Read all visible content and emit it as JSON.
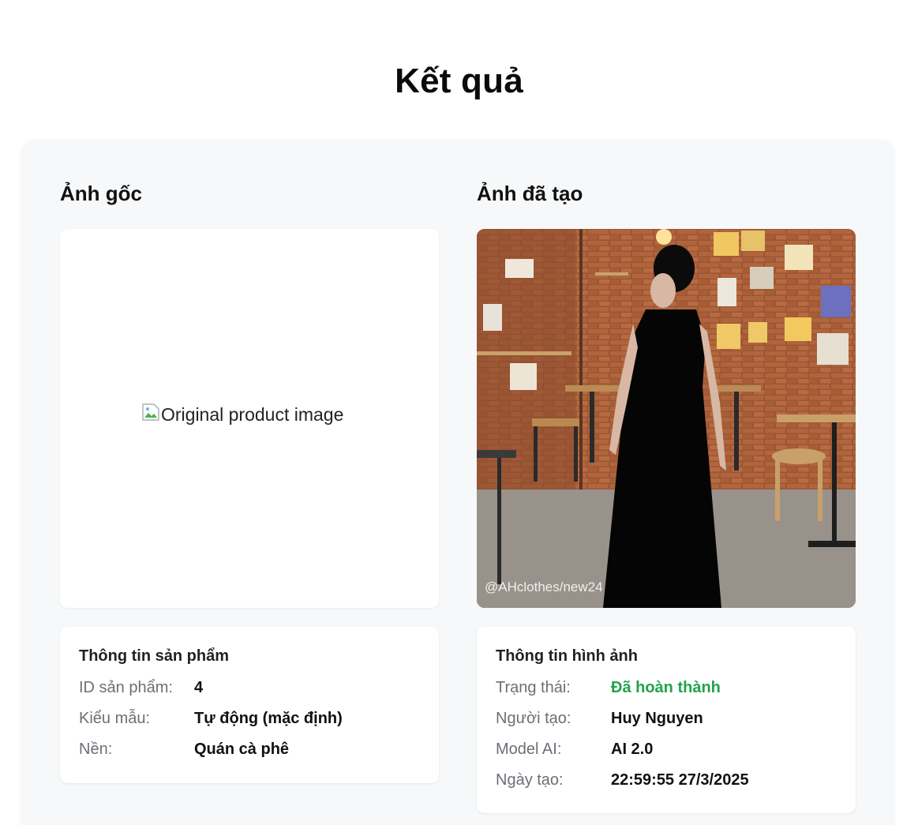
{
  "page": {
    "title": "Kết quả"
  },
  "original": {
    "heading": "Ảnh gốc",
    "image_alt": "Original product image"
  },
  "generated": {
    "heading": "Ảnh đã tạo",
    "watermark": "@AHclothes/new24"
  },
  "product_info": {
    "title": "Thông tin sản phẩm",
    "rows": [
      {
        "label": "ID sản phẩm:",
        "value": "4"
      },
      {
        "label": "Kiểu mẫu:",
        "value": "Tự động (mặc định)"
      },
      {
        "label": "Nền:",
        "value": "Quán cà phê"
      }
    ]
  },
  "image_info": {
    "title": "Thông tin hình ảnh",
    "rows": [
      {
        "label": "Trạng thái:",
        "value": "Đã hoàn thành"
      },
      {
        "label": "Người tạo:",
        "value": "Huy Nguyen"
      },
      {
        "label": "Model AI:",
        "value": "AI 2.0"
      },
      {
        "label": "Ngày tạo:",
        "value": "22:59:55 27/3/2025"
      }
    ]
  },
  "colors": {
    "status_complete": "#22a24a",
    "panel_bg": "#f7f8fa"
  },
  "icons": {
    "broken_image": "broken-image-icon"
  }
}
